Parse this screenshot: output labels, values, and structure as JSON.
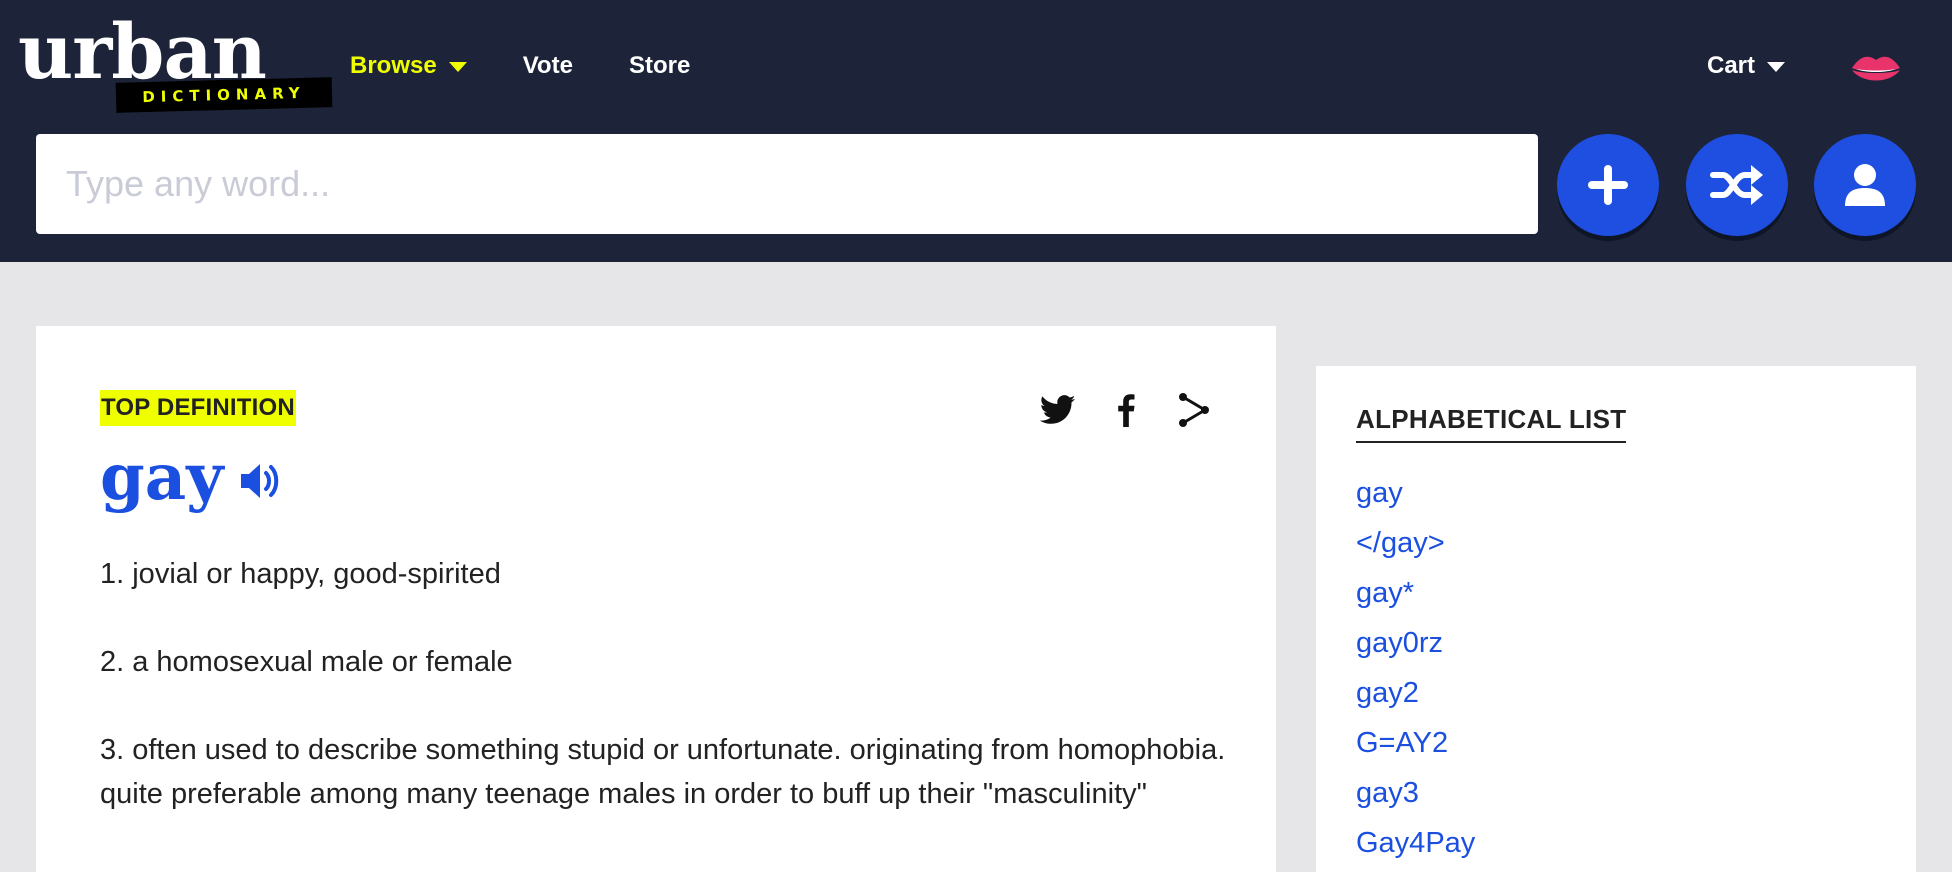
{
  "header": {
    "logo": {
      "word": "urban",
      "tagline": "DICTIONARY"
    },
    "nav": [
      {
        "label": "Browse"
      },
      {
        "label": "Vote"
      },
      {
        "label": "Store"
      }
    ],
    "cart_label": "Cart",
    "search": {
      "placeholder": "Type any word...",
      "value": ""
    }
  },
  "colors": {
    "header_bg": "#1d2439",
    "accent_yellow": "#efff00",
    "button_blue": "#1f4fe0",
    "link_blue": "#1a4fe0"
  },
  "icons": [
    "plus-icon",
    "shuffle-icon",
    "user-icon",
    "lips-icon",
    "twitter-icon",
    "facebook-icon",
    "share-icon",
    "speaker-icon",
    "chevron-down-icon"
  ],
  "definition": {
    "badge": "TOP DEFINITION",
    "word": "gay",
    "meanings": [
      "1. jovial or happy, good-spirited",
      "2. a homosexual male or female",
      "3. often used to describe something stupid or unfortunate. originating from homophobia. quite preferable among many teenage males in order to buff up their \"masculinity\""
    ]
  },
  "sidebar": {
    "title": "ALPHABETICAL LIST",
    "items": [
      "gay",
      "</gay>",
      "gay*",
      "gay0rz",
      "gay2",
      "G=AY2",
      "gay3",
      "Gay4Pay"
    ]
  }
}
